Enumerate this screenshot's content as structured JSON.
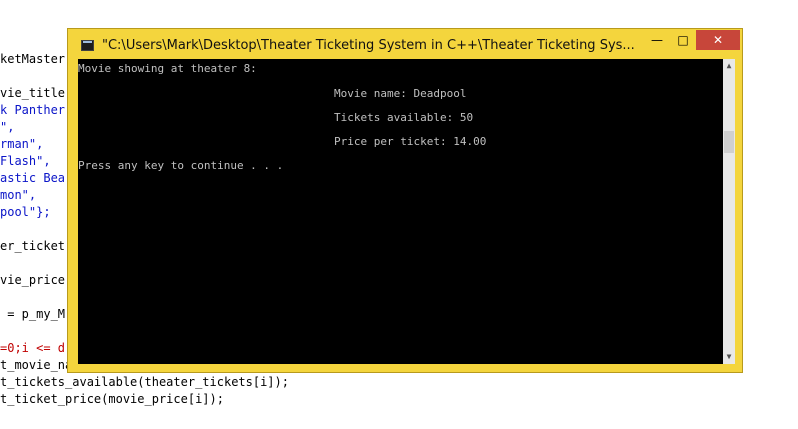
{
  "editor": {
    "lines": [
      {
        "text": "ketMaster",
        "color": "black"
      },
      {
        "text": "vie_title",
        "color": "black"
      },
      {
        "text": "k Panther",
        "color": "blue"
      },
      {
        "text": "\",",
        "color": "blue"
      },
      {
        "text": "rman\",",
        "color": "blue"
      },
      {
        "text": "Flash\",",
        "color": "blue"
      },
      {
        "text": "astic Bea",
        "color": "blue"
      },
      {
        "text": "mon\",",
        "color": "blue"
      },
      {
        "text": "pool\"};",
        "color": "blue"
      },
      {
        "text": "er_ticket",
        "color": "black"
      },
      {
        "text": "vie_price",
        "color": "black"
      },
      {
        "text": " = p_my_M",
        "color": "black"
      },
      {
        "text": "=0;i <= d",
        "color": "red"
      },
      {
        "text": "t_movie_name(movie_titles[i]);",
        "color": "black"
      },
      {
        "text": "t_tickets_available(theater_tickets[i]);",
        "color": "black"
      },
      {
        "text": "t_ticket_price(movie_price[i]);",
        "color": "black"
      }
    ]
  },
  "window": {
    "title": "\"C:\\Users\\Mark\\Desktop\\Theater Ticketing System in C++\\Theater Ticketing Sys...",
    "minimize_label": "—",
    "maximize_label": "□",
    "close_label": "✕"
  },
  "console": {
    "lines": [
      "Movie showing at theater 8:",
      "Movie name: Deadpool",
      "Tickets available: 50",
      "Price per ticket: 14.00",
      "Press any key to continue . . ."
    ]
  },
  "scrollbar": {
    "up_label": "▲",
    "down_label": "▼"
  }
}
